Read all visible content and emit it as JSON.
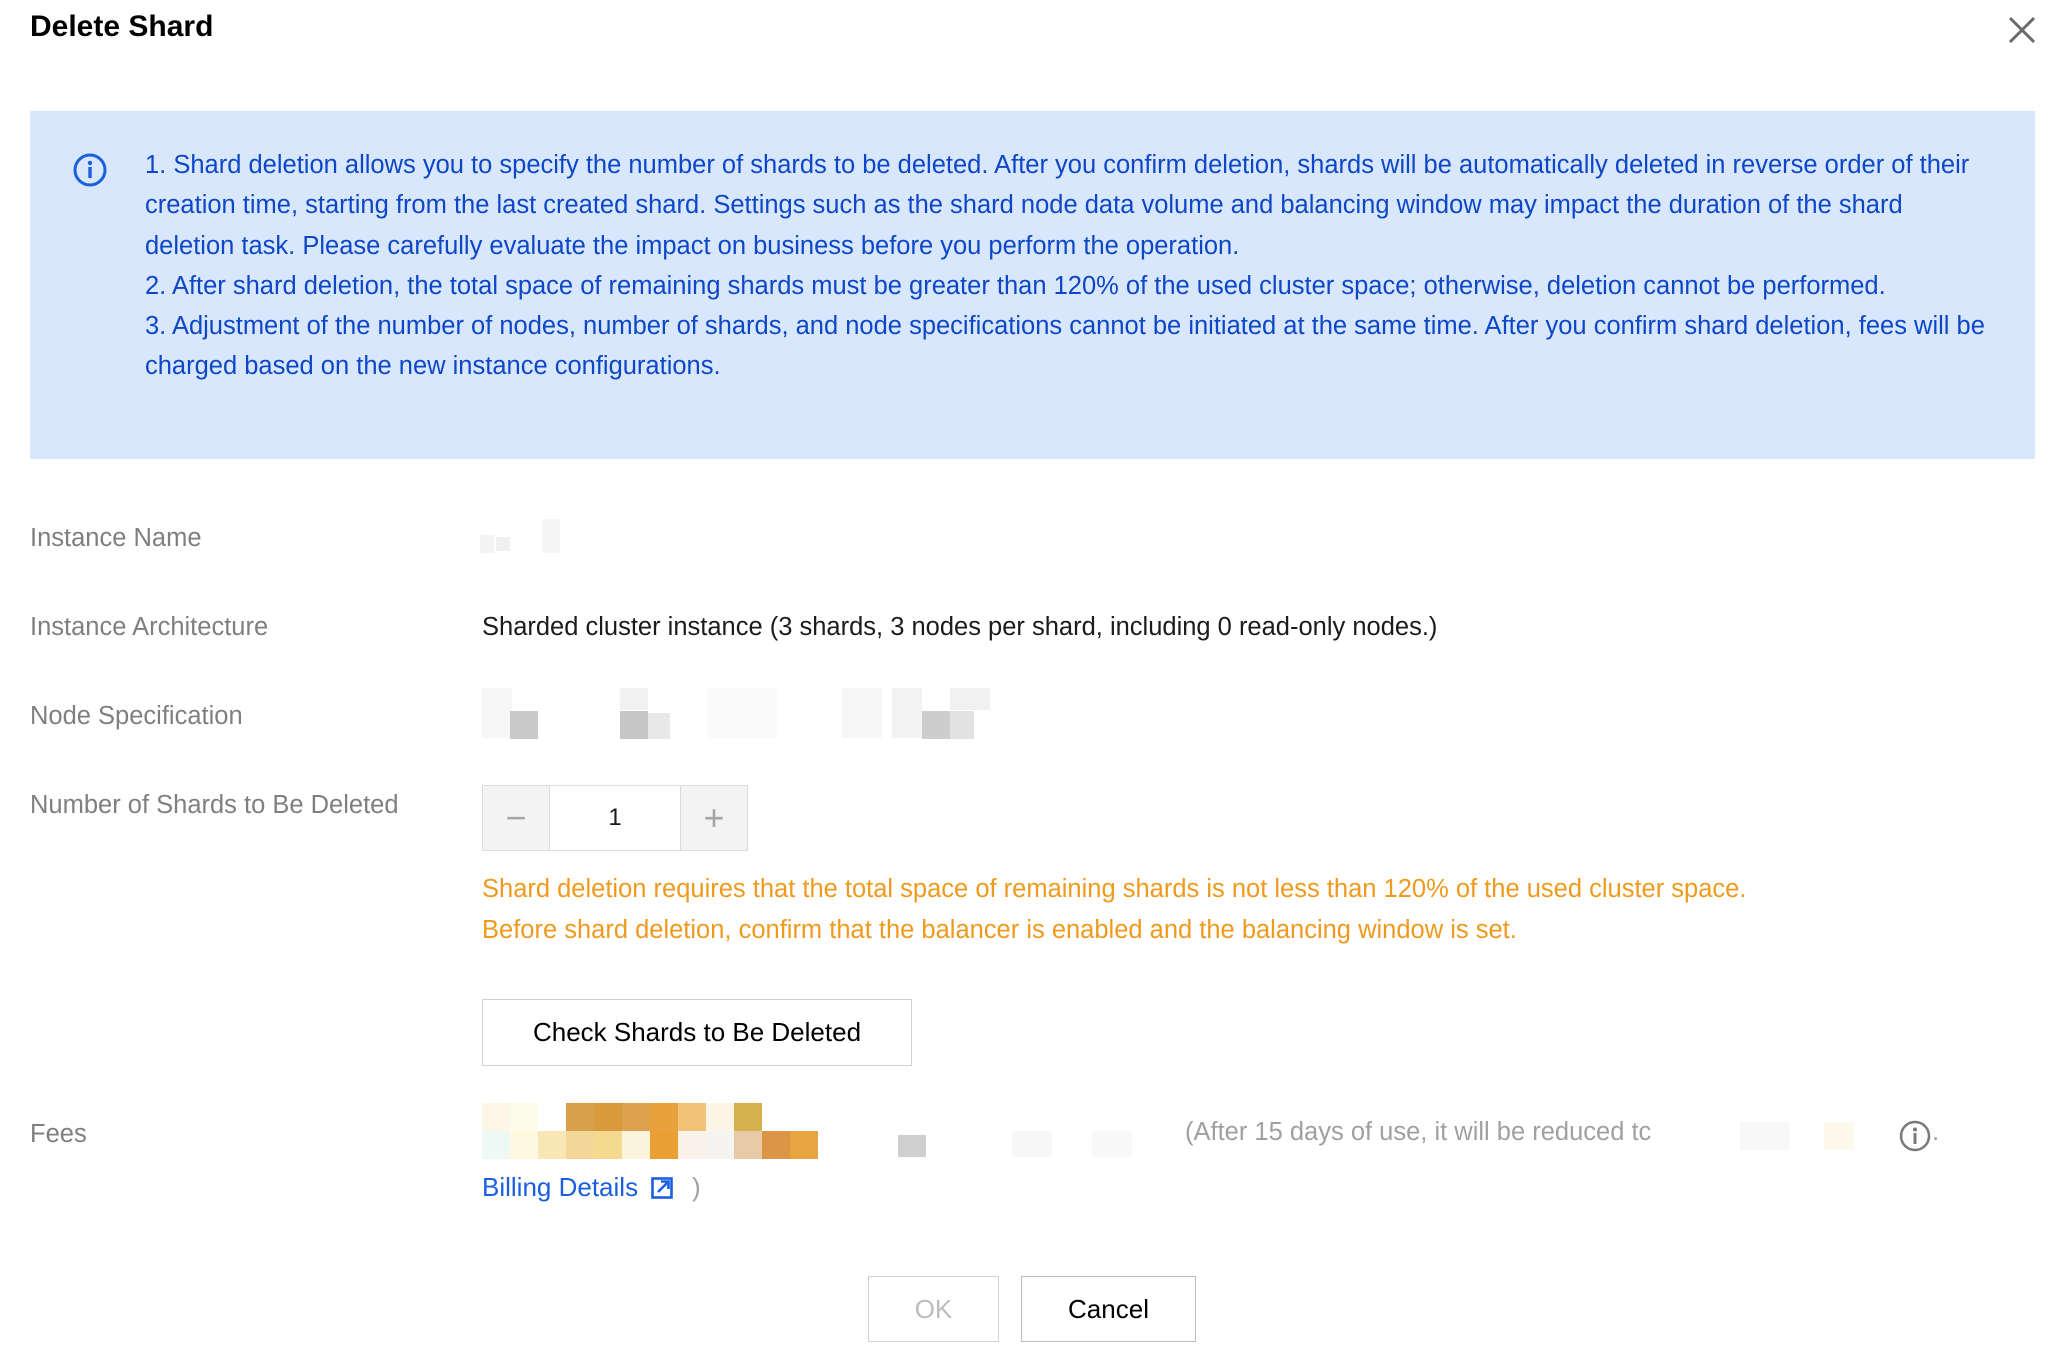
{
  "dialog": {
    "title": "Delete Shard",
    "close_icon": "close-icon"
  },
  "notice": {
    "icon": "info-icon",
    "lines": [
      "1. Shard deletion allows you to specify the number of shards to be deleted. After you confirm deletion, shards will be automatically deleted in reverse order of their creation time, starting from the last created shard. Settings such as the shard node data volume and balancing window may impact the duration of the shard deletion task. Please carefully evaluate the impact on business before you perform the operation.",
      "2. After shard deletion, the total space of remaining shards must be greater than 120% of the used cluster space; otherwise, deletion cannot be performed.",
      "3. Adjustment of the number of nodes, number of shards, and node specifications cannot be initiated at the same time. After you confirm shard deletion, fees will be charged based on the new instance configurations."
    ],
    "bg_color": "#d9e7fd",
    "text_color": "#0d47c8"
  },
  "form": {
    "instance_name_label": "Instance Name",
    "instance_architecture_label": "Instance Architecture",
    "instance_architecture_value": "Sharded cluster instance (3 shards, 3 nodes per shard, including 0 read-only nodes.)",
    "node_specification_label": "Node Specification",
    "shards_to_delete_label": "Number of Shards to Be Deleted",
    "shards_to_delete_value": "1",
    "stepper_minus": "−",
    "stepper_plus": "+",
    "warning_lines": [
      "Shard deletion requires that the total space of remaining shards is not less than 120% of the used cluster space.",
      "Before shard deletion, confirm that the balancer is enabled and the balancing window is set."
    ],
    "warning_color": "#ef9a1d",
    "check_button_label": "Check Shards to Be Deleted",
    "fees_label": "Fees",
    "fees_note": "(After 15 days of use, it will be reduced tc",
    "fees_dot": ".",
    "billing_details_label": "Billing Details",
    "billing_close_paren": ")",
    "link_color": "#1a5fe0"
  },
  "footer": {
    "ok_label": "OK",
    "cancel_label": "Cancel"
  }
}
